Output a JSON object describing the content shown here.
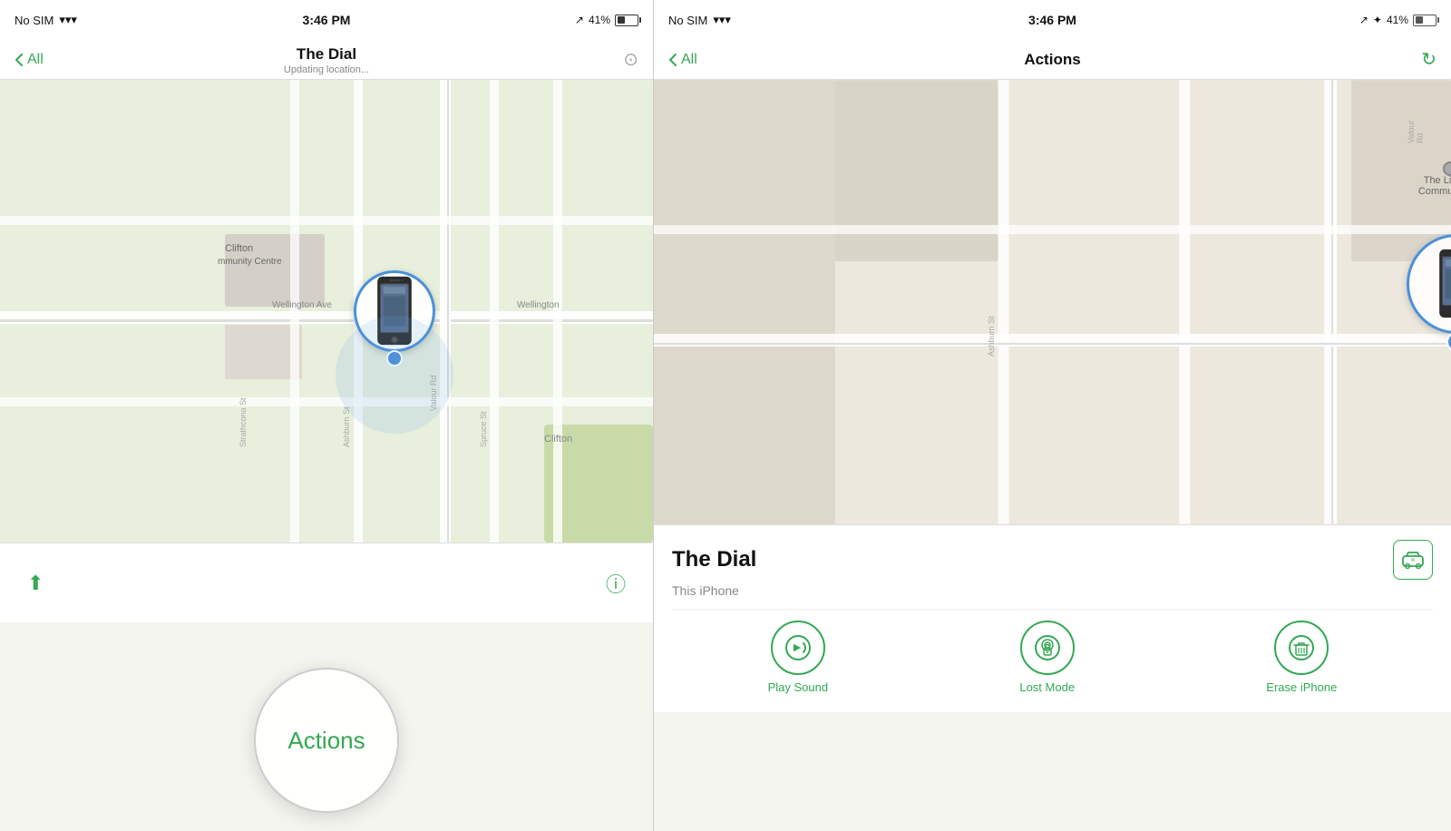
{
  "left_phone": {
    "status": {
      "carrier": "No SIM",
      "wifi": "📶",
      "time": "3:46 PM",
      "location": "↗",
      "battery_pct": "41%"
    },
    "nav": {
      "back_label": "All",
      "title": "The Dial",
      "subtitle": "Updating location..."
    },
    "map": {
      "labels": [
        "Clifton",
        "Community Centre",
        "Wellington Ave",
        "Wellington",
        "Strathcona St",
        "Ashburn St",
        "Valour Rd",
        "Spruce St",
        "Clifton"
      ]
    },
    "actions_button_label": "Actions",
    "bottom": {
      "location_icon": "⬆",
      "info_icon": "ⓘ"
    }
  },
  "right_phone": {
    "status": {
      "carrier": "No SIM",
      "wifi": "📶",
      "time": "3:46 PM",
      "location": "↗",
      "bluetooth": "✦",
      "battery_pct": "41%"
    },
    "nav": {
      "back_label": "All",
      "title": "Actions"
    },
    "map": {
      "labels": [
        "The Living Christ Community Church",
        "Ashburn St",
        "Valour Rd"
      ]
    },
    "device_info": {
      "name": "The Dial",
      "subtitle": "This iPhone"
    },
    "actions": [
      {
        "id": "play-sound",
        "label": "Play Sound",
        "icon": "🔊"
      },
      {
        "id": "lost-mode",
        "label": "Lost Mode",
        "icon": "🔒"
      },
      {
        "id": "erase-iphone",
        "label": "Erase iPhone",
        "icon": "🗑"
      }
    ]
  }
}
